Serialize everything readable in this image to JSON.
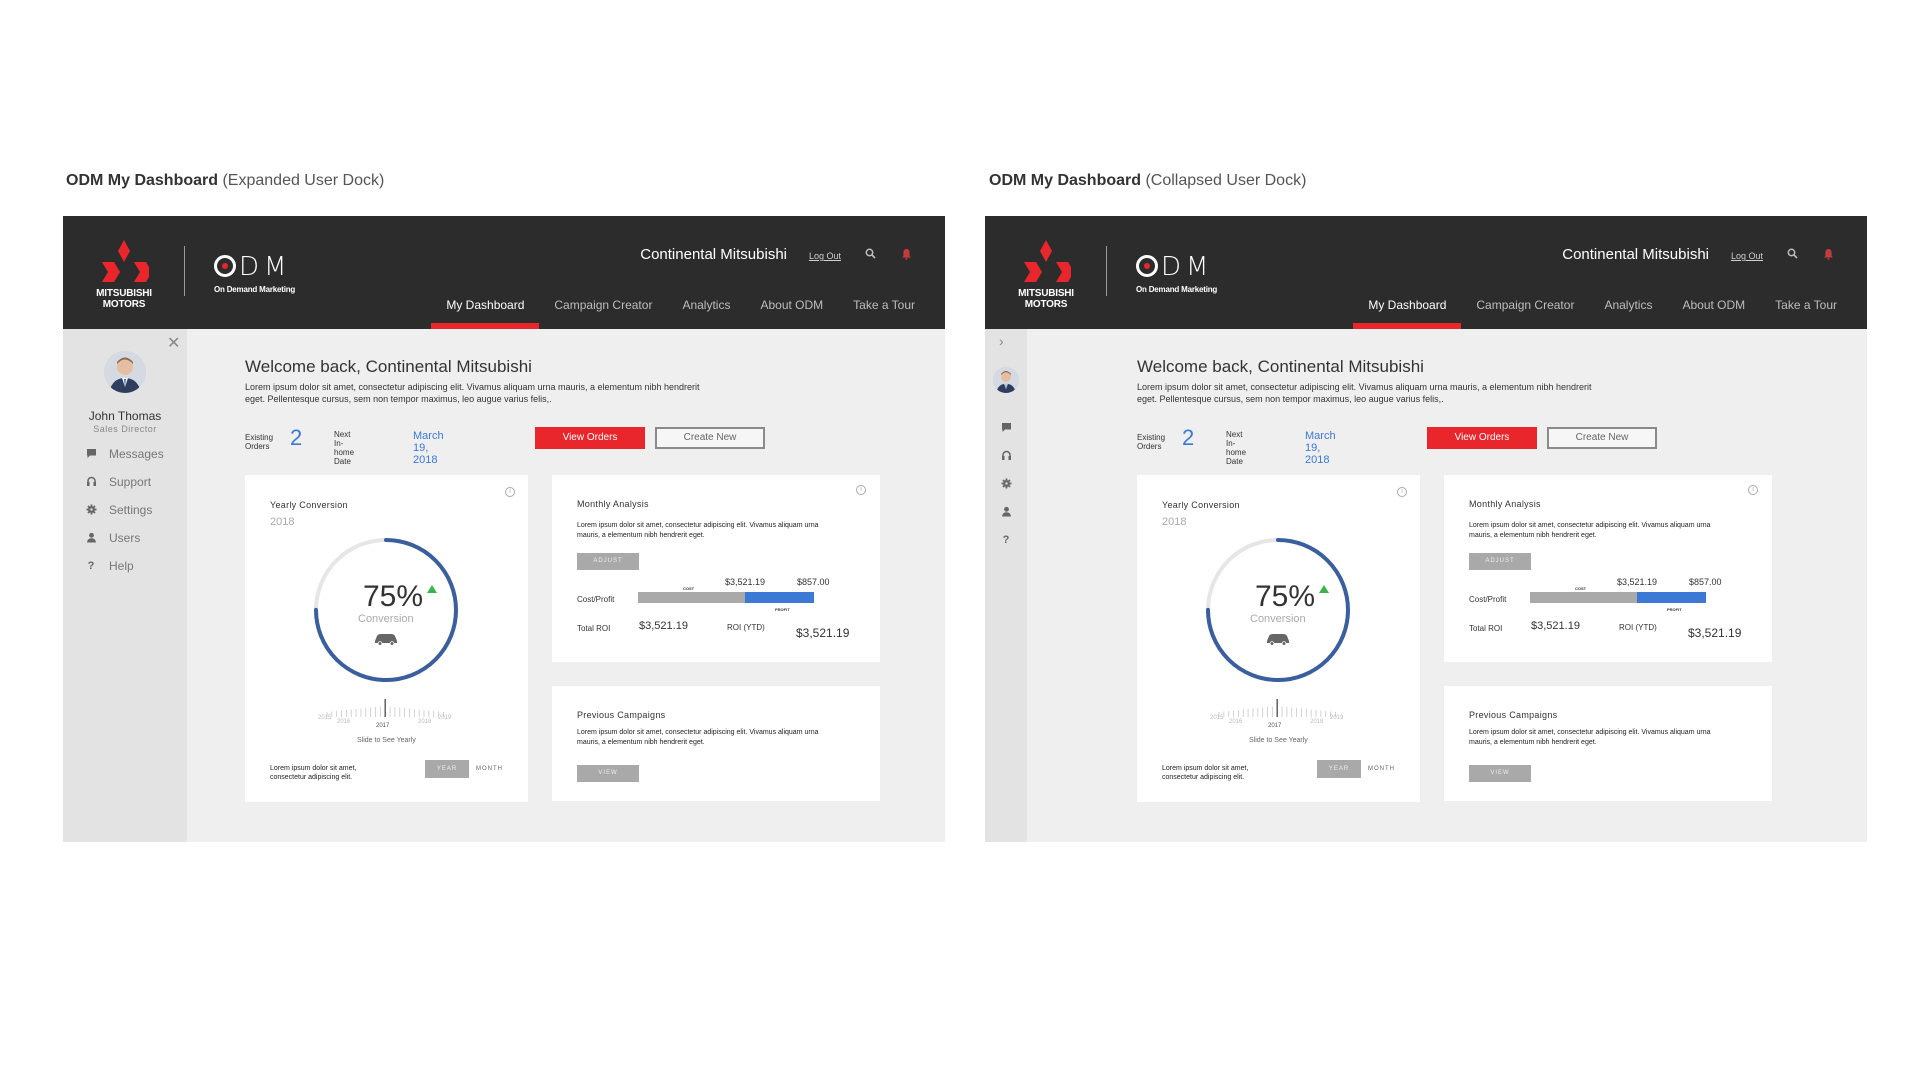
{
  "panels": [
    {
      "caption_bold": "ODM My Dashboard",
      "caption_sub": "(Expanded User Dock)"
    },
    {
      "caption_bold": "ODM My Dashboard",
      "caption_sub": "(Collapsed User Dock)"
    }
  ],
  "brand": {
    "logo_text_1": "MITSUBISHI",
    "logo_text_2": "MOTORS",
    "odm_letters": "DM",
    "odm_tagline": "On Demand Marketing",
    "accent": "#e8262b",
    "header_bg": "#2c2c2c",
    "link_blue": "#3c79d4"
  },
  "header": {
    "dealer": "Continental Mitsubishi",
    "logout": "Log Out",
    "search_icon": "search-icon",
    "bell_icon": "bell-icon"
  },
  "nav": [
    "My Dashboard",
    "Campaign Creator",
    "Analytics",
    "About ODM",
    "Take a Tour"
  ],
  "user": {
    "name": "John Thomas",
    "role": "Sales Director"
  },
  "dock": [
    {
      "label": "Messages",
      "icon": "chat-icon"
    },
    {
      "label": "Support",
      "icon": "headset-icon"
    },
    {
      "label": "Settings",
      "icon": "gear-icon"
    },
    {
      "label": "Users",
      "icon": "user-icon"
    },
    {
      "label": "Help",
      "icon": "help-icon"
    }
  ],
  "welcome": {
    "title": "Welcome back, Continental Mitsubishi",
    "text": "Lorem ipsum dolor sit amet, consectetur adipiscing elit. Vivamus aliquam urna mauris, a elementum nibh hendrerit eget. Pellentesque cursus, sem non tempor maximus, leo augue varius felis,."
  },
  "stats": {
    "orders_label_1": "Existing",
    "orders_label_2": "Orders",
    "orders_value": "2",
    "date_label_1": "Next In-home",
    "date_label_2": "Date",
    "date_value": "March 19, 2018",
    "view_orders": "View Orders",
    "create_new": "Create New"
  },
  "yearly": {
    "title": "Yearly Conversion",
    "year": "2018",
    "percent": "75%",
    "percent_value": 75,
    "label": "Conversion",
    "slider_years": [
      "2015",
      "2016",
      "2017",
      "2018",
      "2019"
    ],
    "slider_current": "2017",
    "slide_hint": "Slide to See Yearly",
    "footnote_1": "Lorem ipsum dolor sit amet,",
    "footnote_2": "consectetur adipiscing elit.",
    "toggle_year": "YEAR",
    "toggle_month": "MONTH"
  },
  "monthly": {
    "title": "Monthly Analysis",
    "text_1": "Lorem ipsum dolor sit amet, consectetur adipiscing elit. Vivamus aliquam urna",
    "text_2": "mauris, a elementum nibh hendrerit eget.",
    "adjust": "ADJUST",
    "cost_label": "Cost/Profit",
    "cost_value": "$3,521.19",
    "profit_value": "$857.00",
    "cost_tag": "COST",
    "profit_tag": "PROFIT",
    "profit_fraction": 0.39,
    "total_roi_label": "Total ROI",
    "total_roi_value": "$3,521.19",
    "roi_ytd_label": "ROI (YTD)",
    "roi_ytd_value": "$3,521.19"
  },
  "previous": {
    "title": "Previous Campaigns",
    "text_1": "Lorem ipsum dolor sit amet, consectetur adipiscing elit. Vivamus aliquam urna",
    "text_2": "mauris, a elementum nibh hendrerit eget.",
    "view": "VIEW"
  }
}
